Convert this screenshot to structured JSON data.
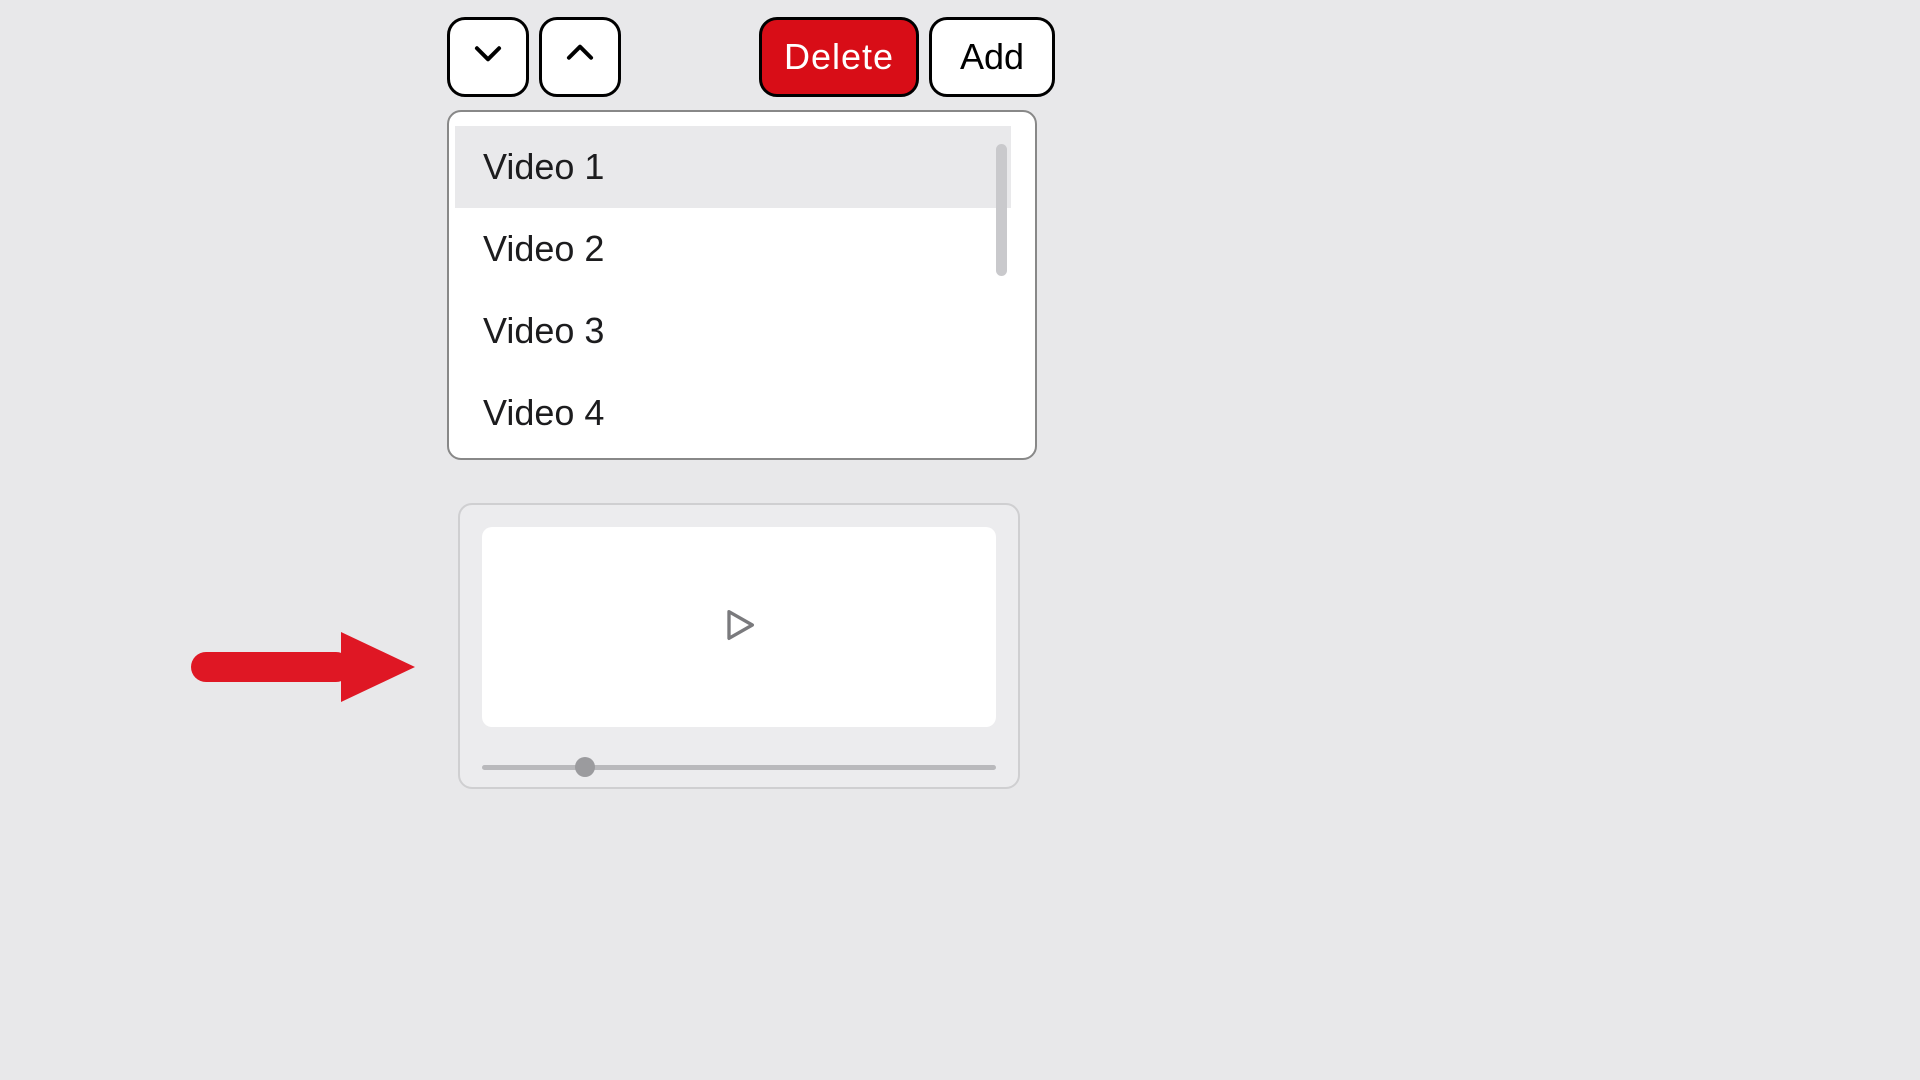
{
  "toolbar": {
    "delete_label": "Delete",
    "add_label": "Add"
  },
  "list": {
    "items": [
      {
        "label": "Video 1",
        "selected": true
      },
      {
        "label": "Video 2",
        "selected": false
      },
      {
        "label": "Video 3",
        "selected": false
      },
      {
        "label": "Video 4",
        "selected": false
      }
    ]
  },
  "player": {
    "progress_percent": 20
  },
  "colors": {
    "danger": "#d80d17",
    "background": "#e8e8ea"
  }
}
